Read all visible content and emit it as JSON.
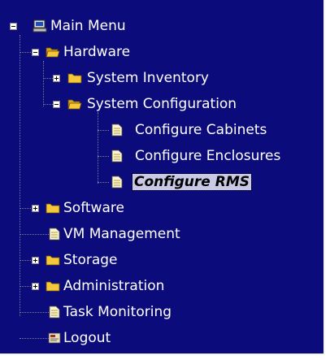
{
  "tree": {
    "root": {
      "label": "Main Menu",
      "icon": "computer-icon",
      "expanded": true
    },
    "items": [
      {
        "label": "Hardware",
        "icon": "folder-open-icon",
        "expanded": true
      },
      {
        "label": "System Inventory",
        "icon": "folder-icon",
        "expanded": false
      },
      {
        "label": "System Configuration",
        "icon": "folder-open-icon",
        "expanded": true
      },
      {
        "label": "Configure Cabinets",
        "icon": "document-icon"
      },
      {
        "label": "Configure Enclosures",
        "icon": "document-icon"
      },
      {
        "label": "Configure RMS",
        "icon": "document-icon",
        "selected": true
      },
      {
        "label": "Software",
        "icon": "folder-icon",
        "expanded": false
      },
      {
        "label": "VM Management",
        "icon": "document-icon"
      },
      {
        "label": "Storage",
        "icon": "folder-icon",
        "expanded": false
      },
      {
        "label": "Administration",
        "icon": "folder-icon",
        "expanded": false
      },
      {
        "label": "Task Monitoring",
        "icon": "document-icon"
      },
      {
        "label": "Logout",
        "icon": "logout-icon"
      }
    ]
  },
  "colors": {
    "background": "#0c0b7c",
    "text": "#ffffff",
    "folder": "#f5c73a",
    "selection": "#c9c9e6"
  }
}
